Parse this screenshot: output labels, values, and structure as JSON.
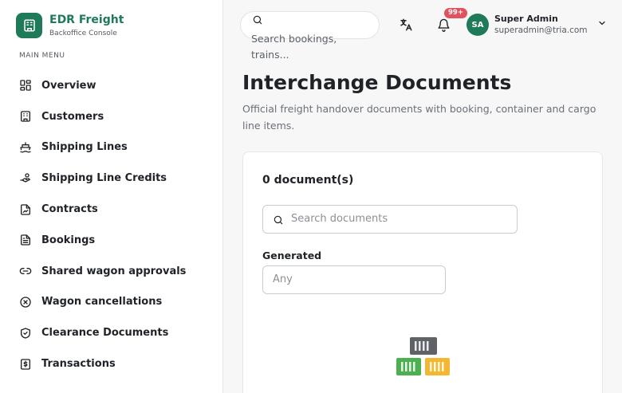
{
  "brand": {
    "name": "EDR Freight",
    "subtitle": "Backoffice Console",
    "color": "#1f7a5a",
    "icon": "building-icon"
  },
  "sidebar": {
    "heading": "MAIN MENU",
    "items": [
      {
        "label": "Overview",
        "icon": "dashboard-grid-icon"
      },
      {
        "label": "Customers",
        "icon": "building-icon"
      },
      {
        "label": "Shipping Lines",
        "icon": "ship-icon"
      },
      {
        "label": "Shipping Line Credits",
        "icon": "hand-coins-icon"
      },
      {
        "label": "Contracts",
        "icon": "file-signature-icon"
      },
      {
        "label": "Bookings",
        "icon": "file-text-icon"
      },
      {
        "label": "Shared wagon approvals",
        "icon": "link-icon"
      },
      {
        "label": "Wagon cancellations",
        "icon": "circle-x-icon"
      },
      {
        "label": "Clearance Documents",
        "icon": "shield-check-icon"
      },
      {
        "label": "Transactions",
        "icon": "receipt-dollar-icon"
      }
    ]
  },
  "topbar": {
    "search_placeholder": "Search bookings, trains...",
    "notification_badge": "99+",
    "user": {
      "initials": "SA",
      "name": "Super Admin",
      "email": "superadmin@tria.com"
    }
  },
  "page": {
    "title": "Interchange Documents",
    "subtitle": "Official freight handover documents with booking, container and cargo line items."
  },
  "card": {
    "count_label": "0 document(s)",
    "search_placeholder": "Search documents",
    "filter_label": "Generated",
    "filter_value": "Any"
  },
  "colors": {
    "accent": "#1f7a5a",
    "badge": "#e05260",
    "container_dark": "#5f6368",
    "container_green": "#4caf50",
    "container_yellow": "#f5b731"
  }
}
